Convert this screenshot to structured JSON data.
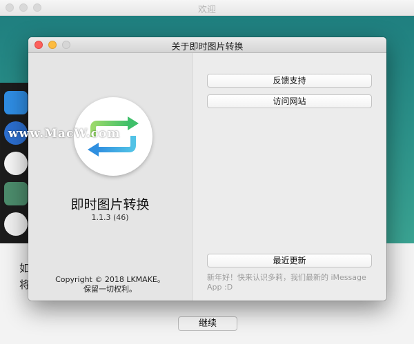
{
  "background_window": {
    "title": "欢迎",
    "text_line1": "如",
    "text_line2": "将",
    "continue_label": "继续"
  },
  "dialog": {
    "title": "关于即时图片转换",
    "app_name": "即时图片转换",
    "version": "1.1.3 (46)",
    "copyright_line1": "Copyright © 2018 LKMAKE。",
    "copyright_line2": "保留一切权利。",
    "feedback_label": "反馈支持",
    "website_label": "访问网站",
    "latest_update_label": "最近更新",
    "changelog_text": "新年好！快来认识多莉，我们最新的 iMessage App :D"
  },
  "watermark": "www.MacW.com",
  "icons": {
    "app_icon": "swap-arrows-icon"
  },
  "colors": {
    "arrow_green": "#5cc85a",
    "arrow_blue": "#3ba0e8",
    "close": "#fc605c",
    "minimize": "#fdbc40"
  }
}
